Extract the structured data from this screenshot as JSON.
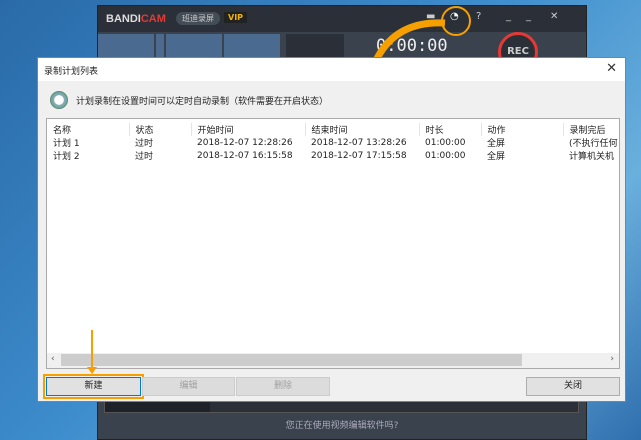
{
  "app": {
    "logo_a": "BANDI",
    "logo_b": "CAM",
    "chip": "班迪录屏",
    "vip": "VIP",
    "timer": "0:00:00",
    "rec": "REC",
    "help": "?",
    "minimize": "_",
    "close": "✕",
    "hint": "您正在使用视频编辑软件吗?"
  },
  "dialog": {
    "title": "录制计划列表",
    "close": "✕",
    "info": "计划录制在设置时间可以定时自动录制（软件需要在开启状态）",
    "columns": [
      "名称",
      "状态",
      "开始时间",
      "结束时间",
      "时长",
      "动作",
      "录制完后"
    ],
    "rows": [
      [
        "计划 1",
        "过时",
        "2018-12-07 12:28:26",
        "2018-12-07 13:28:26",
        "01:00:00",
        "全屏",
        "(不执行任何"
      ],
      [
        "计划 2",
        "过时",
        "2018-12-07 16:15:58",
        "2018-12-07 17:15:58",
        "01:00:00",
        "全屏",
        "计算机关机"
      ]
    ],
    "buttons": {
      "new": "新建",
      "edit": "编辑",
      "delete": "删除",
      "close": "关闭"
    },
    "scroll_left": "‹",
    "scroll_right": "›"
  },
  "colors": {
    "accent": "#f5a000",
    "rec": "#e53935"
  }
}
